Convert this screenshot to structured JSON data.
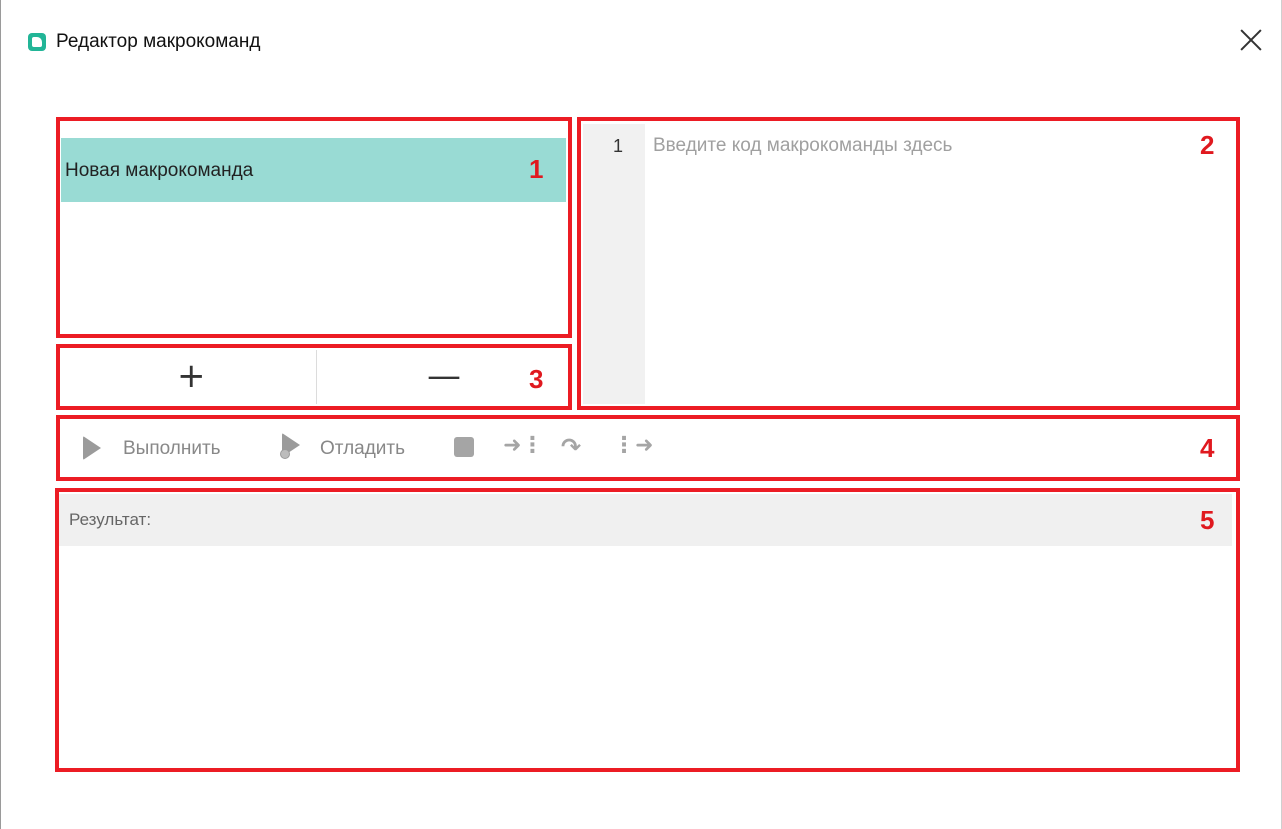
{
  "window": {
    "title": "Редактор макрокоманд"
  },
  "macro_list": {
    "items": [
      "Новая макрокоманда"
    ]
  },
  "editor": {
    "line_numbers": [
      "1"
    ],
    "placeholder": "Введите код макрокоманды здесь"
  },
  "list_controls": {
    "add_symbol": "+",
    "remove_symbol": "—"
  },
  "toolbar": {
    "run_label": "Выполнить",
    "debug_label": "Отладить"
  },
  "result": {
    "label": "Результат:"
  },
  "annotations": [
    "1",
    "2",
    "3",
    "4",
    "5"
  ],
  "colors": {
    "annotation": "#ec1c24",
    "selected_item": "#99dbd4",
    "app_icon": "#22b597"
  }
}
